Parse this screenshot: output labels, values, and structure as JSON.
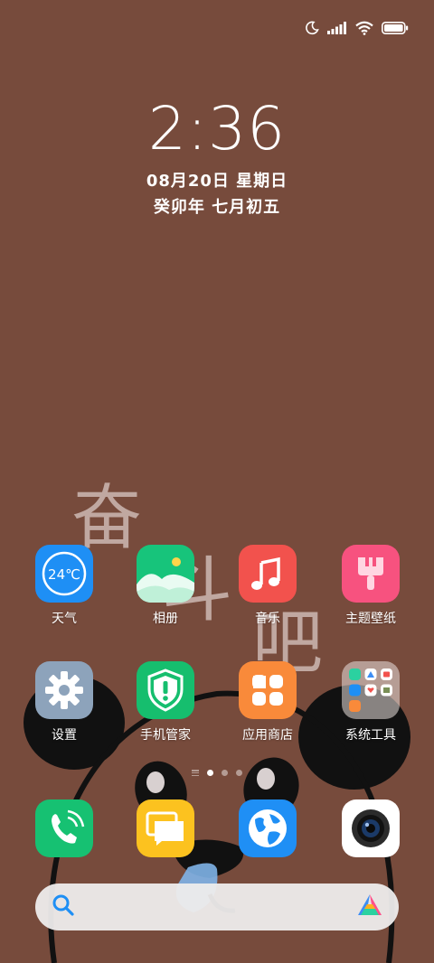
{
  "status_bar": {
    "icons": [
      "moon-icon",
      "cellular-signal-icon",
      "wifi-icon",
      "battery-icon"
    ]
  },
  "clock": {
    "time": "2:36",
    "date": "08月20日 星期日",
    "lunar_date": "癸卯年 七月初五"
  },
  "wallpaper": {
    "text_1": "奋",
    "text_2": "斗",
    "text_3": "吧",
    "background_color": "#774b3c"
  },
  "apps": {
    "weather": {
      "label": "天气",
      "badge": "24℃",
      "color": "#1e8ff5"
    },
    "gallery": {
      "label": "相册",
      "color": "#17c47b"
    },
    "music": {
      "label": "音乐",
      "color": "#f2524d"
    },
    "themes": {
      "label": "主题壁纸",
      "color": "#f7527f"
    },
    "settings": {
      "label": "设置",
      "color": "#8da3bb"
    },
    "security": {
      "label": "手机管家",
      "color": "#16be6e"
    },
    "app_store": {
      "label": "应用商店",
      "color": "#f98a3a"
    },
    "tools_folder": {
      "label": "系统工具"
    }
  },
  "page_indicator": {
    "pages": 3,
    "active": 1
  },
  "dock": {
    "phone": {
      "color": "#16c172"
    },
    "messages": {
      "color": "#fcc21f"
    },
    "browser": {
      "color": "#1f8ff5"
    },
    "camera": {
      "color": "#ffffff"
    }
  },
  "search": {
    "icons": [
      "search-icon",
      "assistant-icon"
    ]
  }
}
